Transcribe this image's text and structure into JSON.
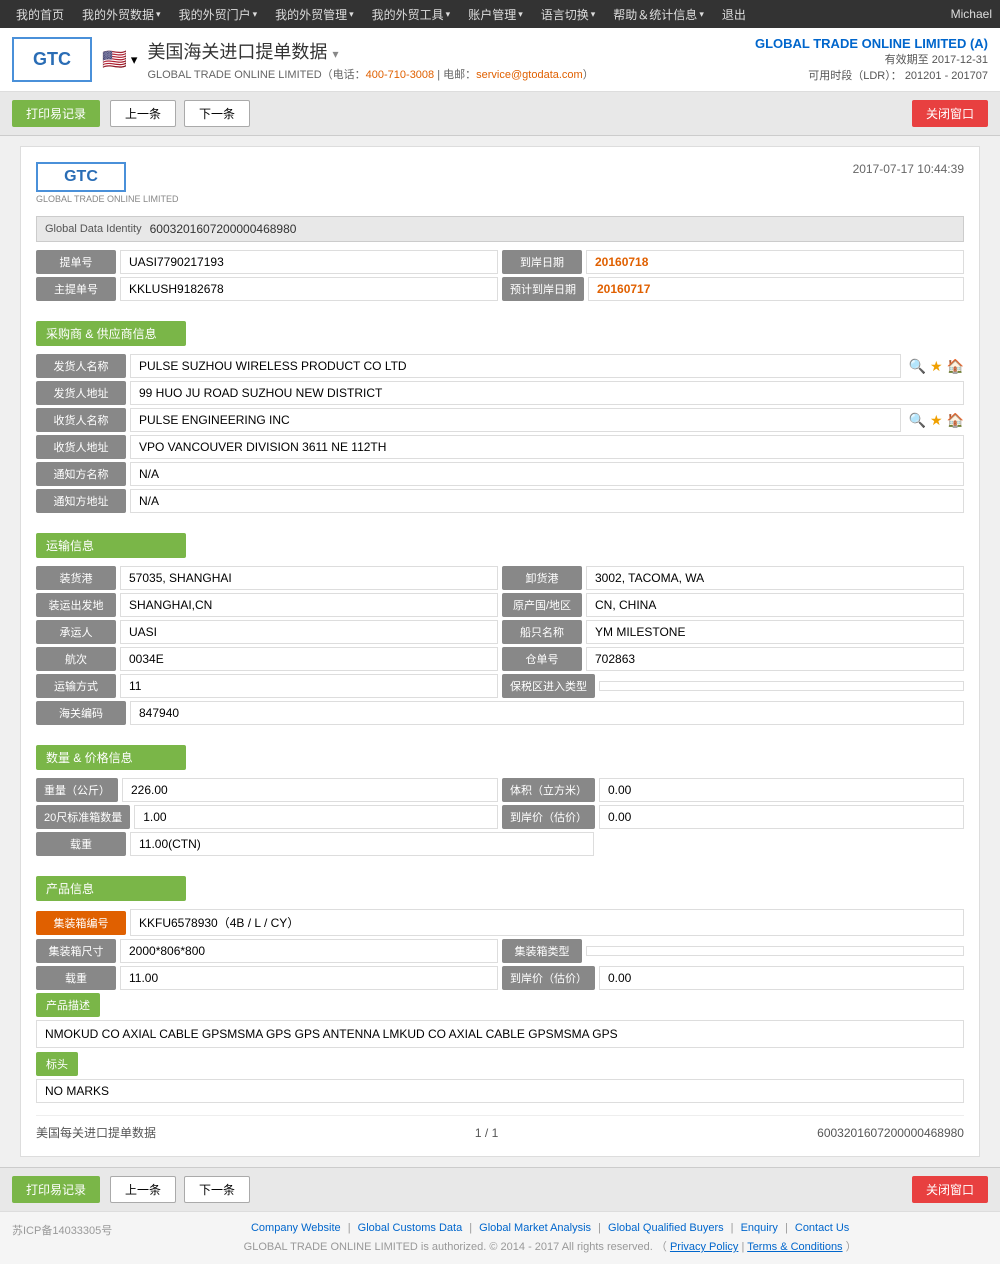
{
  "topnav": {
    "items": [
      {
        "label": "我的首页",
        "id": "home"
      },
      {
        "label": "我的外贸数据",
        "id": "data",
        "arrow": true
      },
      {
        "label": "我的外贸门户",
        "id": "portal",
        "arrow": true
      },
      {
        "label": "我的外贸管理",
        "id": "manage",
        "arrow": true
      },
      {
        "label": "我的外贸工具",
        "id": "tools",
        "arrow": true
      },
      {
        "label": "账户管理",
        "id": "account",
        "arrow": true
      },
      {
        "label": "语言切换",
        "id": "lang",
        "arrow": true
      },
      {
        "label": "帮助＆统计信息",
        "id": "help",
        "arrow": true
      },
      {
        "label": "退出",
        "id": "logout"
      }
    ],
    "user": "Michael"
  },
  "header": {
    "logo_text": "GTC",
    "flag_emoji": "🇺🇸",
    "title": "美国海关进口提单数据",
    "subtitle": "GLOBAL TRADE ONLINE LIMITED（电话：400-710-3008 | 电邮：service@gtodata.com）",
    "phone_label": "电话：",
    "phone": "400-710-3008",
    "email_label": "电邮：",
    "email": "service@gtodata.com",
    "account_name": "GLOBAL TRADE ONLINE LIMITED (A)",
    "valid_until_label": "有效期至",
    "valid_until": "2017-12-31",
    "ldr_label": "可用时段（LDR）：",
    "ldr_value": "201201 - 201707"
  },
  "toolbar": {
    "print_btn": "打印易记录",
    "prev_btn": "上一条",
    "next_btn": "下一条",
    "close_btn": "关闭窗口"
  },
  "record": {
    "logo_text": "GTC",
    "datetime": "2017-07-17  10:44:39",
    "global_data_identity_label": "Global Data Identity",
    "global_data_identity_value": "6003201607200000468980",
    "bill_number_label": "提单号",
    "bill_number_value": "UASI7790217193",
    "arrival_date_label": "到岸日期",
    "arrival_date_value": "20160718",
    "master_bill_label": "主提单号",
    "master_bill_value": "KKLUSH9182678",
    "expected_arrival_label": "预计到岸日期",
    "expected_arrival_value": "20160717",
    "sections": {
      "buyer_supplier": {
        "title": "采购商 & 供应商信息",
        "shipper_name_label": "发货人名称",
        "shipper_name_value": "PULSE SUZHOU WIRELESS PRODUCT CO LTD",
        "shipper_addr_label": "发货人地址",
        "shipper_addr_value": "99 HUO JU ROAD SUZHOU NEW DISTRICT",
        "consignee_name_label": "收货人名称",
        "consignee_name_value": "PULSE ENGINEERING INC",
        "consignee_addr_label": "收货人地址",
        "consignee_addr_value": "VPO VANCOUVER DIVISION 3611 NE 112TH",
        "notify_name_label": "通知方名称",
        "notify_name_value": "N/A",
        "notify_addr_label": "通知方地址",
        "notify_addr_value": "N/A"
      },
      "shipping": {
        "title": "运输信息",
        "loading_port_label": "装货港",
        "loading_port_value": "57035, SHANGHAI",
        "discharge_port_label": "卸货港",
        "discharge_port_value": "3002, TACOMA, WA",
        "loading_place_label": "装运出发地",
        "loading_place_value": "SHANGHAI,CN",
        "origin_label": "原产国/地区",
        "origin_value": "CN, CHINA",
        "carrier_label": "承运人",
        "carrier_value": "UASI",
        "vessel_label": "船只名称",
        "vessel_value": "YM MILESTONE",
        "voyage_label": "航次",
        "voyage_value": "0034E",
        "warehouse_label": "仓单号",
        "warehouse_value": "702863",
        "transport_mode_label": "运输方式",
        "transport_mode_value": "11",
        "bonded_zone_label": "保税区进入类型",
        "bonded_zone_value": "",
        "customs_code_label": "海关编码",
        "customs_code_value": "847940"
      },
      "quantity_price": {
        "title": "数量 & 价格信息",
        "weight_label": "重量（公斤）",
        "weight_value": "226.00",
        "volume_label": "体积（立方米）",
        "volume_value": "0.00",
        "containers_20_label": "20尺标准箱数量",
        "containers_20_value": "1.00",
        "arrival_price_label": "到岸价（估价）",
        "arrival_price_value": "0.00",
        "quantity_label": "载重",
        "quantity_value": "11.00(CTN)"
      },
      "product": {
        "title": "产品信息",
        "container_no_label": "集装箱编号",
        "container_no_value": "KKFU6578930（4B / L / CY）",
        "container_size_label": "集装箱尺寸",
        "container_size_value": "2000*806*800",
        "container_type_label": "集装箱类型",
        "container_type_value": "",
        "quantity_label": "载重",
        "quantity_value": "11.00",
        "arrival_price_label": "到岸价（估价）",
        "arrival_price_value": "0.00",
        "product_desc_label": "产品描述",
        "product_desc_value": "NMOKUD CO AXIAL CABLE GPSMSMA GPS GPS ANTENNA LMKUD CO AXIAL CABLE GPSMSMA GPS",
        "marks_label": "标头",
        "marks_value": "NO MARKS"
      }
    },
    "footer": {
      "db_label": "美国每关进口提单数据",
      "page_info": "1 / 1",
      "record_id": "6003201607200000468980"
    }
  },
  "footer": {
    "icp": "苏ICP备14033305号",
    "links": [
      {
        "label": "Company Website"
      },
      {
        "label": "Global Customs Data"
      },
      {
        "label": "Global Market Analysis"
      },
      {
        "label": "Global Qualified Buyers"
      },
      {
        "label": "Enquiry"
      },
      {
        "label": "Contact Us"
      }
    ],
    "copyright": "GLOBAL TRADE ONLINE LIMITED is authorized. © 2014 - 2017 All rights reserved.",
    "privacy": "Privacy Policy",
    "terms": "Terms & Conditions"
  }
}
